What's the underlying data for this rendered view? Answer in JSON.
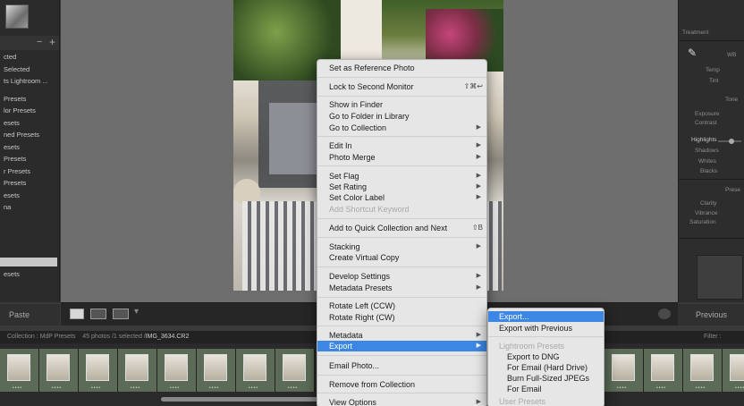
{
  "left_panel": {
    "items": [
      "cted",
      "Selected",
      "ts Lightroom ...",
      "",
      "Presets",
      "lor Presets",
      "esets",
      "ned Presets",
      "esets",
      "Presets",
      "r Presets",
      "Presets",
      "esets",
      "na",
      "",
      "",
      "",
      "",
      ""
    ],
    "presets_label": "esets",
    "paste_label": "Paste"
  },
  "right_panel": {
    "treatment_label": "Treatment",
    "wb_label": "WB",
    "temp_label": "Temp",
    "tint_label": "Tint",
    "tone_label": "Tone",
    "exposure_label": "Exposure",
    "contrast_label": "Contrast",
    "highlights_label": "Highlights",
    "shadows_label": "Shadows",
    "whites_label": "Whites",
    "blacks_label": "Blacks",
    "presence_label": "Prese",
    "clarity_label": "Clarity",
    "vibrance_label": "Vibrance",
    "saturation_label": "Saturation",
    "previous_label": "Previous"
  },
  "filmstrip": {
    "collection_text": "Collection : MdP Presets",
    "count_text": "45 photos /1 selected /",
    "filename": "IMG_3634.CR2",
    "filter_label": "Filter :"
  },
  "context_menu": {
    "items": [
      {
        "label": "Set as Reference Photo"
      },
      {
        "label": "Lock to Second Monitor",
        "shortcut": "⇧⌘↩"
      },
      {
        "label": "Show in Finder"
      },
      {
        "label": "Go to Folder in Library"
      },
      {
        "label": "Go to Collection"
      },
      {
        "label": "Edit In"
      },
      {
        "label": "Photo Merge"
      },
      {
        "label": "Set Flag"
      },
      {
        "label": "Set Rating"
      },
      {
        "label": "Set Color Label"
      },
      {
        "label": "Add Shortcut Keyword"
      },
      {
        "label": "Add to Quick Collection and Next",
        "shortcut": "⇧B"
      },
      {
        "label": "Stacking"
      },
      {
        "label": "Create Virtual Copy"
      },
      {
        "label": "Develop Settings"
      },
      {
        "label": "Metadata Presets"
      },
      {
        "label": "Rotate Left (CCW)"
      },
      {
        "label": "Rotate Right (CW)"
      },
      {
        "label": "Metadata"
      },
      {
        "label": "Export"
      },
      {
        "label": "Email Photo..."
      },
      {
        "label": "Remove from Collection"
      },
      {
        "label": "View Options"
      }
    ]
  },
  "export_submenu": {
    "items": [
      {
        "label": "Export..."
      },
      {
        "label": "Export with Previous"
      },
      {
        "label": "Lightroom Presets"
      },
      {
        "label": "Export to DNG"
      },
      {
        "label": "For Email (Hard Drive)"
      },
      {
        "label": "Burn Full-Sized JPEGs"
      },
      {
        "label": "For Email"
      },
      {
        "label": "User Presets"
      }
    ]
  },
  "colors": {
    "menu_bg": "#e6e6e6",
    "highlight": "#3c86e4",
    "app_bg": "#3a3a3a"
  }
}
